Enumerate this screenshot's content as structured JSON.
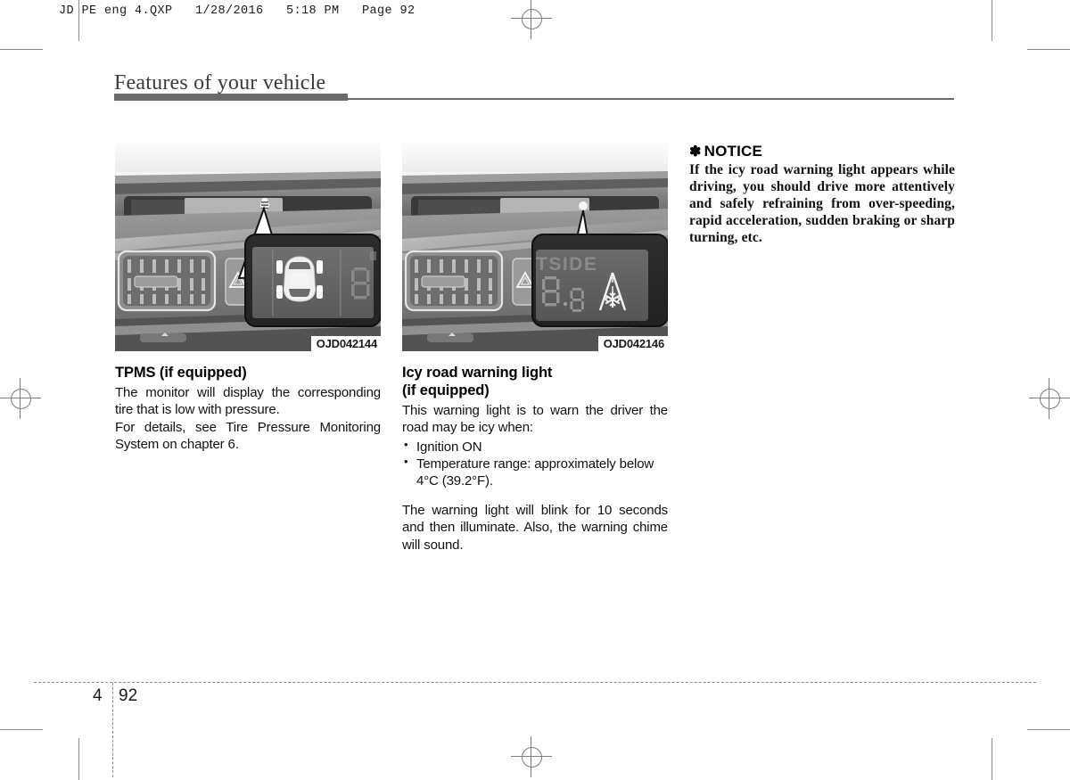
{
  "print_header": "JD PE eng 4.QXP   1/28/2016   5:18 PM   Page 92",
  "page_title": "Features of your vehicle",
  "columns": [
    {
      "figure": {
        "caption": "OJD042144",
        "alt_name": "tpms-dashboard-photo"
      },
      "heading": "TPMS (if equipped)",
      "paragraphs": [
        "The monitor will display the corresponding tire that is low with pressure.",
        "For details, see Tire Pressure Monitoring System on chapter 6."
      ]
    },
    {
      "figure": {
        "caption": "OJD042146",
        "alt_name": "icy-road-dashboard-photo"
      },
      "heading_line1": "Icy road warning light",
      "heading_line2": "(if equipped)",
      "intro": "This warning light is to warn the driver the road may be icy when:",
      "bullets": [
        "Ignition ON",
        "Temperature range: approximately below 4°C (39.2°F)."
      ],
      "closing": "The warning light will blink for 10 seconds and then illuminate. Also, the warning chime will sound."
    },
    {
      "notice_symbol": "✽",
      "notice_title": "NOTICE",
      "notice_body": "If the icy road warning light appears while driving, you should drive more attentively and safely refraining from over-speeding, rapid acceleration, sudden braking or sharp turning, etc."
    }
  ],
  "footer": {
    "chapter": "4",
    "page": "92"
  },
  "display_labels": {
    "outside_text": "TSIDE",
    "digit_left": "8",
    "digit_right": "8"
  },
  "colors": {
    "rule": "#6b6b6b",
    "crop_mark": "#8a8a8a",
    "text": "#111111",
    "title": "#3b3b3b"
  }
}
